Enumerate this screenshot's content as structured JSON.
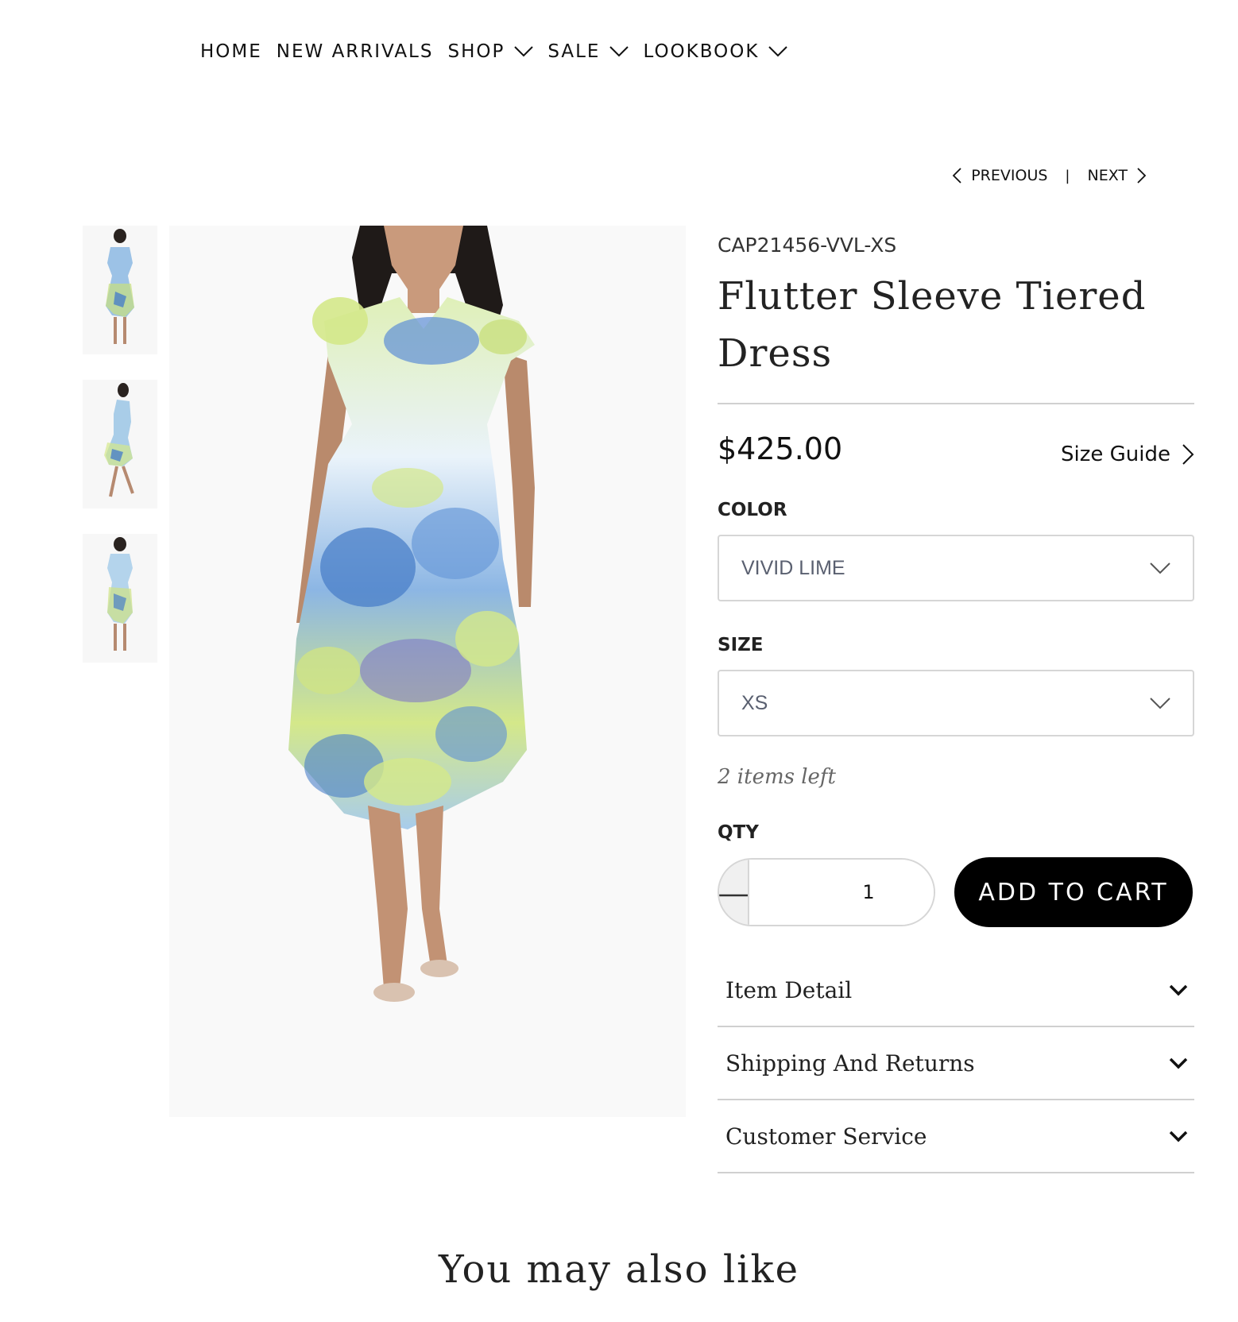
{
  "nav": {
    "items": [
      {
        "label": "HOME",
        "has_dropdown": false
      },
      {
        "label": "NEW ARRIVALS",
        "has_dropdown": false
      },
      {
        "label": "SHOP",
        "has_dropdown": true
      },
      {
        "label": "SALE",
        "has_dropdown": true
      },
      {
        "label": "LOOKBOOK",
        "has_dropdown": true
      }
    ]
  },
  "pager": {
    "previous": "PREVIOUS",
    "separator": "|",
    "next": "NEXT"
  },
  "product": {
    "sku": "CAP21456-VVL-XS",
    "title_line1": "Flutter Sleeve Tiered",
    "title_line2": "Dress",
    "price": "$425.00",
    "size_guide": "Size Guide",
    "color_label": "COLOR",
    "color_value": "VIVID LIME",
    "size_label": "SIZE",
    "size_value": "XS",
    "stock_text": "2 items left",
    "qty_label": "QTY",
    "qty_value": "1",
    "add_to_cart": "ADD TO CART"
  },
  "accordion": [
    {
      "label": "Item Detail"
    },
    {
      "label": "Shipping And Returns"
    },
    {
      "label": "Customer Service"
    }
  ],
  "related": {
    "heading": "You may also like"
  },
  "colors": {
    "dress_blue": "#4a7fc8",
    "dress_lime": "#d4e88a",
    "button_black": "#000000"
  }
}
